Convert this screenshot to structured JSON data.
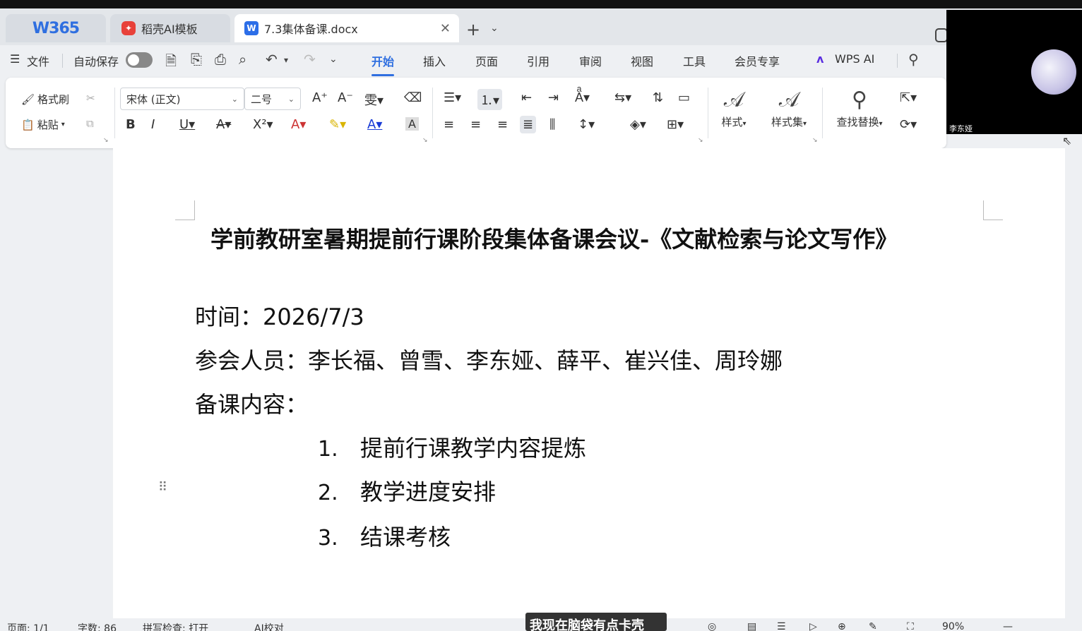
{
  "tabs": {
    "home": "W365",
    "ai_template": "稻壳AI模板",
    "document": "7.3集体备课.docx"
  },
  "menu": {
    "file": "文件",
    "autosave": "自动保存",
    "tabs": [
      "开始",
      "插入",
      "页面",
      "引用",
      "审阅",
      "视图",
      "工具",
      "会员专享"
    ],
    "wps_ai": "WPS AI"
  },
  "ribbon": {
    "format_painter": "格式刷",
    "paste": "粘贴",
    "font_name": "宋体 (正文)",
    "font_size": "二号",
    "styles": "样式",
    "style_set": "样式集",
    "find_replace": "查找替换"
  },
  "document": {
    "title": "学前教研室暑期提前行课阶段集体备课会议-《文献检索与论文写作》",
    "time_label": "时间：",
    "time_value": "2026/7/3",
    "participants": "参会人员：李长福、曾雪、李东娅、薛平、崔兴佳、周玲娜",
    "content_label": "备课内容：",
    "items": [
      {
        "num": "1.",
        "text": "提前行课教学内容提炼"
      },
      {
        "num": "2.",
        "text": "教学进度安排"
      },
      {
        "num": "3.",
        "text": "结课考核"
      }
    ]
  },
  "statusbar": {
    "page": "页面: 1/1",
    "words": "字数: 86",
    "spellcheck": "拼写检查: 打开",
    "ai_proofread": "AI校对",
    "zoom": "90%"
  },
  "overlay": {
    "subtitle": "我现在脑袋有点卡壳",
    "participant_name": "李东娅"
  }
}
